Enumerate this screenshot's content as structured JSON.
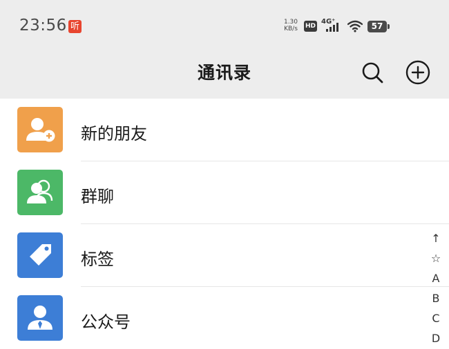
{
  "status_bar": {
    "time": "23:56",
    "listen_badge": "听",
    "net_speed_value": "1.30",
    "net_speed_unit": "KB/s",
    "hd_label": "HD",
    "network_type": "4G⁺",
    "battery": "57"
  },
  "header": {
    "title": "通讯录",
    "search_icon": "search-icon",
    "add_icon": "plus-circle-icon"
  },
  "list": [
    {
      "label": "新的朋友",
      "icon": "add-friend-icon",
      "color": "#f0a04b"
    },
    {
      "label": "群聊",
      "icon": "group-chat-icon",
      "color": "#4cb867"
    },
    {
      "label": "标签",
      "icon": "tag-icon",
      "color": "#3d7ed6"
    },
    {
      "label": "公众号",
      "icon": "official-account-icon",
      "color": "#3d7ed6"
    }
  ],
  "index_bar": [
    "↑",
    "☆",
    "A",
    "B",
    "C",
    "D"
  ],
  "colors": {
    "header_bg": "#ededed",
    "page_bg": "#ffffff",
    "divider": "#e6e6e6",
    "text": "#1a1a1a"
  }
}
